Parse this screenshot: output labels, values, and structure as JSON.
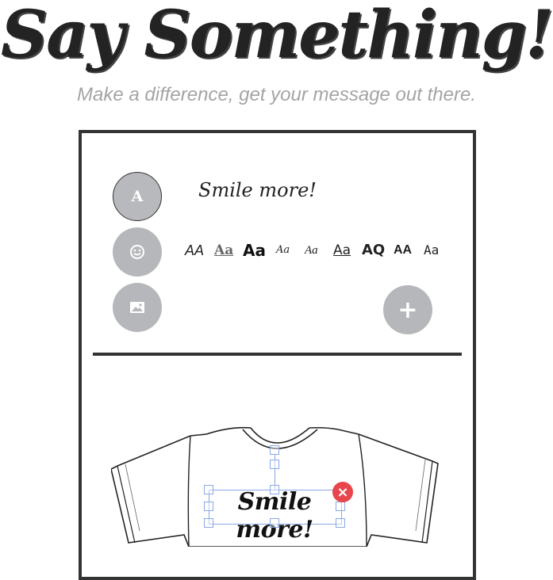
{
  "hero": {
    "title": "Say Something!",
    "subtitle": "Make a difference, get your message out there."
  },
  "tools": [
    {
      "name": "text-tool",
      "icon": "text-icon",
      "label": "A",
      "active": true
    },
    {
      "name": "emoji-tool",
      "icon": "smiley-icon",
      "active": false
    },
    {
      "name": "image-tool",
      "icon": "image-icon",
      "active": false
    }
  ],
  "text_editor": {
    "preview_text": "Smile more!",
    "font_samples": [
      "AA",
      "Aa",
      "Aa",
      "Aa",
      "Aa",
      "Aa",
      "AQ",
      "AA",
      "Aa"
    ],
    "add_label": "+"
  },
  "canvas": {
    "product": "t-shirt",
    "text": "Smile more!",
    "delete_label": "×"
  },
  "colors": {
    "accent_gray": "#b6b7ba",
    "frame": "#333333",
    "subtitle": "#a4a4a4",
    "selection": "#8aa8e6",
    "delete": "#e8454c"
  }
}
